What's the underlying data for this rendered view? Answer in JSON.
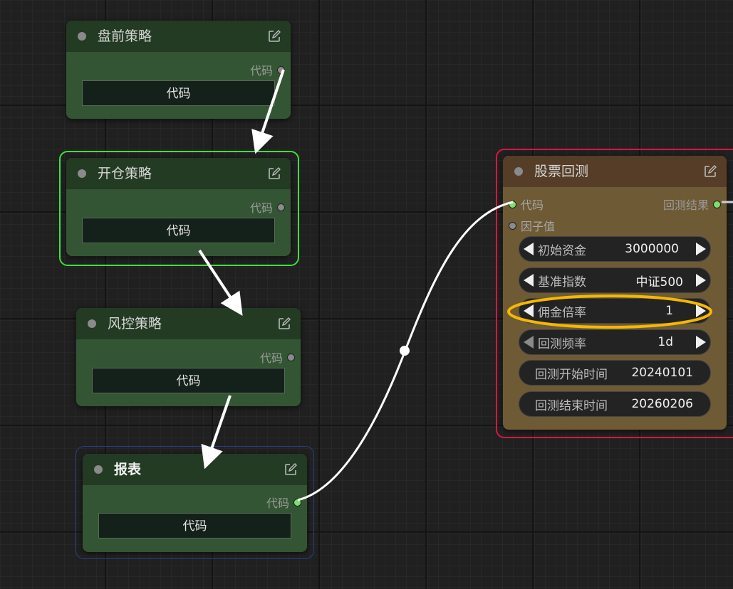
{
  "nodes": {
    "pre": {
      "title": "盘前策略",
      "output": "代码",
      "widget": "代码"
    },
    "open": {
      "title": "开仓策略",
      "output": "代码",
      "widget": "代码"
    },
    "risk": {
      "title": "风控策略",
      "output": "代码",
      "widget": "代码"
    },
    "report": {
      "title": "报表",
      "output": "代码",
      "widget": "代码"
    },
    "backtest": {
      "title": "股票回测",
      "inputs": [
        "代码",
        "因子值"
      ],
      "output": "回测结果",
      "widgets": [
        {
          "label": "初始资金",
          "value": "3000000"
        },
        {
          "label": "基准指数",
          "value": "中证500"
        },
        {
          "label": "佣金倍率",
          "value": "1"
        },
        {
          "label": "回测频率",
          "value": "1d"
        },
        {
          "label": "回测开始时间",
          "value": "20240101"
        },
        {
          "label": "回测结束时间",
          "value": "20260206"
        }
      ]
    }
  },
  "colors": {
    "selected_node": "#3ee03e",
    "report_outline": "#2a3e86",
    "backtest_outline": "#d81840",
    "highlight_ellipse": "#f5b800",
    "port_connected": "#7ee06c"
  },
  "icons": [
    "edit-icon",
    "status-dot-icon",
    "arrow-left-icon",
    "arrow-right-icon"
  ]
}
